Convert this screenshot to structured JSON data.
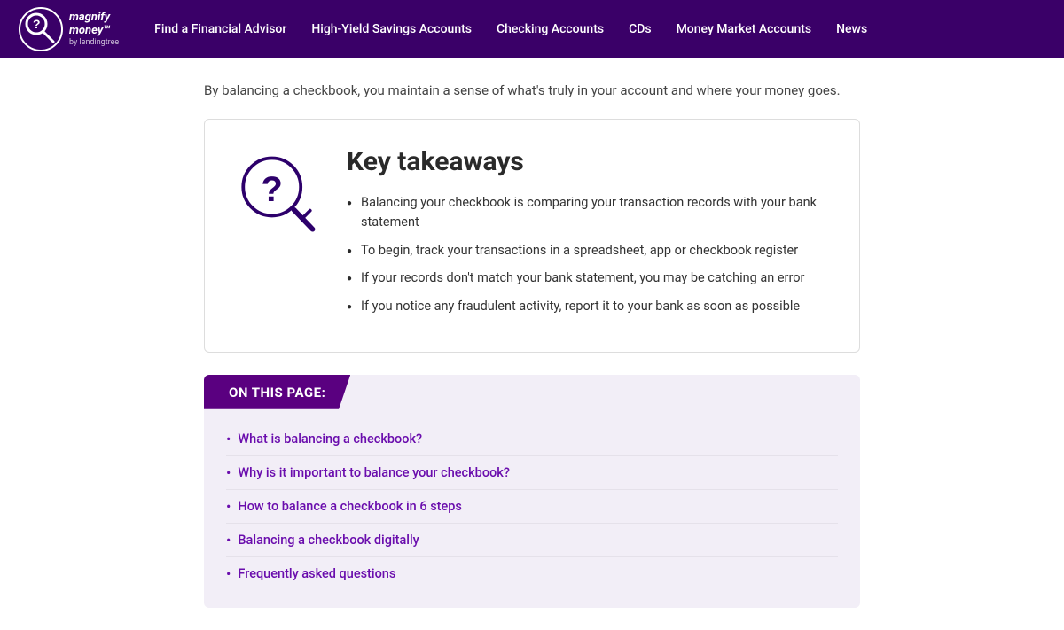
{
  "nav": {
    "logo_text": "magnify\nmoney",
    "logo_sub": "by lendingtree",
    "links": [
      {
        "label": "Find a Financial Advisor",
        "id": "find-advisor"
      },
      {
        "label": "High-Yield Savings Accounts",
        "id": "high-yield"
      },
      {
        "label": "Checking Accounts",
        "id": "checking"
      },
      {
        "label": "CDs",
        "id": "cds"
      },
      {
        "label": "Money Market Accounts",
        "id": "money-market"
      },
      {
        "label": "News",
        "id": "news"
      }
    ]
  },
  "intro": {
    "text": "By balancing a checkbook, you maintain a sense of what's truly in your account and where your money goes."
  },
  "key_takeaways": {
    "title": "Key takeaways",
    "bullet1": "Balancing your checkbook is comparing your transaction records with your bank statement",
    "bullet2": "To begin, track your transactions in a spreadsheet, app or checkbook register",
    "bullet3": "If your records don't match your bank statement, you may be catching an error",
    "bullet4": "If you notice any fraudulent activity, report it to your bank as soon as possible"
  },
  "on_this_page": {
    "header": "ON THIS PAGE:",
    "links": [
      {
        "label": "What is balancing a checkbook?",
        "id": "link1"
      },
      {
        "label": "Why is it important to balance your checkbook?",
        "id": "link2"
      },
      {
        "label": "How to balance a checkbook in 6 steps",
        "id": "link3"
      },
      {
        "label": "Balancing a checkbook digitally",
        "id": "link4"
      },
      {
        "label": "Frequently asked questions",
        "id": "link5"
      }
    ]
  },
  "colors": {
    "nav_bg": "#3a0068",
    "accent_purple": "#5a0080",
    "link_purple": "#6a0dad",
    "text_dark": "#2a2a2a",
    "text_body": "#444444"
  }
}
